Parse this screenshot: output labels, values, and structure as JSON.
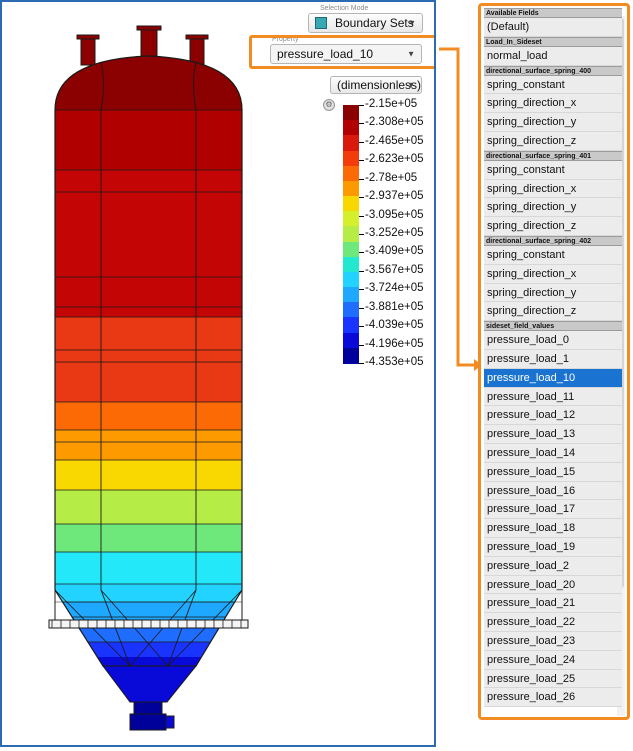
{
  "selection_mode": {
    "label": "Selection Mode",
    "value": "Boundary Sets"
  },
  "property": {
    "label": "Property",
    "value": "pressure_load_10"
  },
  "units": {
    "value": "(dimensionless)"
  },
  "legend": {
    "values": [
      "-2.15e+05",
      "-2.308e+05",
      "-2.465e+05",
      "-2.623e+05",
      "-2.78e+05",
      "-2.937e+05",
      "-3.095e+05",
      "-3.252e+05",
      "-3.409e+05",
      "-3.567e+05",
      "-3.724e+05",
      "-3.881e+05",
      "-4.039e+05",
      "-4.196e+05",
      "-4.353e+05"
    ],
    "colors": [
      "#8b0000",
      "#b00000",
      "#d81a0c",
      "#f23d0a",
      "#fb6a05",
      "#fd9a00",
      "#f8d800",
      "#d6ef2d",
      "#b5ec46",
      "#6ee87a",
      "#22e8cf",
      "#22d3ff",
      "#1ea8ff",
      "#1e6dff",
      "#1a34ff",
      "#0a0ad8",
      "#00009a"
    ]
  },
  "vessel": {
    "band_colors": [
      "#8b0000",
      "#b00000",
      "#c40505",
      "#e83814",
      "#fb6a05",
      "#fd9a00",
      "#f8d800",
      "#b5ec46",
      "#6ee87a",
      "#22e8fa",
      "#22d3ff",
      "#1ea8ff",
      "#1e6dff",
      "#1a34ff",
      "#0a0ad8"
    ]
  },
  "panel": {
    "sections": [
      {
        "header": "Available Fields",
        "items": [
          "(Default)"
        ]
      },
      {
        "header": "Load_In_Sideset",
        "items": [
          "normal_load"
        ]
      },
      {
        "header": "directional_surface_spring_400",
        "items": [
          "spring_constant",
          "spring_direction_x",
          "spring_direction_y",
          "spring_direction_z"
        ]
      },
      {
        "header": "directional_surface_spring_401",
        "items": [
          "spring_constant",
          "spring_direction_x",
          "spring_direction_y",
          "spring_direction_z"
        ]
      },
      {
        "header": "directional_surface_spring_402",
        "items": [
          "spring_constant",
          "spring_direction_x",
          "spring_direction_y",
          "spring_direction_z"
        ]
      },
      {
        "header": "sideset_field_values",
        "items": [
          "pressure_load_0",
          "pressure_load_1",
          "pressure_load_10",
          "pressure_load_11",
          "pressure_load_12",
          "pressure_load_13",
          "pressure_load_14",
          "pressure_load_15",
          "pressure_load_16",
          "pressure_load_17",
          "pressure_load_18",
          "pressure_load_19",
          "pressure_load_2",
          "pressure_load_20",
          "pressure_load_21",
          "pressure_load_22",
          "pressure_load_23",
          "pressure_load_24",
          "pressure_load_25",
          "pressure_load_26"
        ]
      }
    ],
    "selected_item": "pressure_load_10",
    "accent_color": "#f28c22",
    "selection_color": "#1a73d1"
  }
}
